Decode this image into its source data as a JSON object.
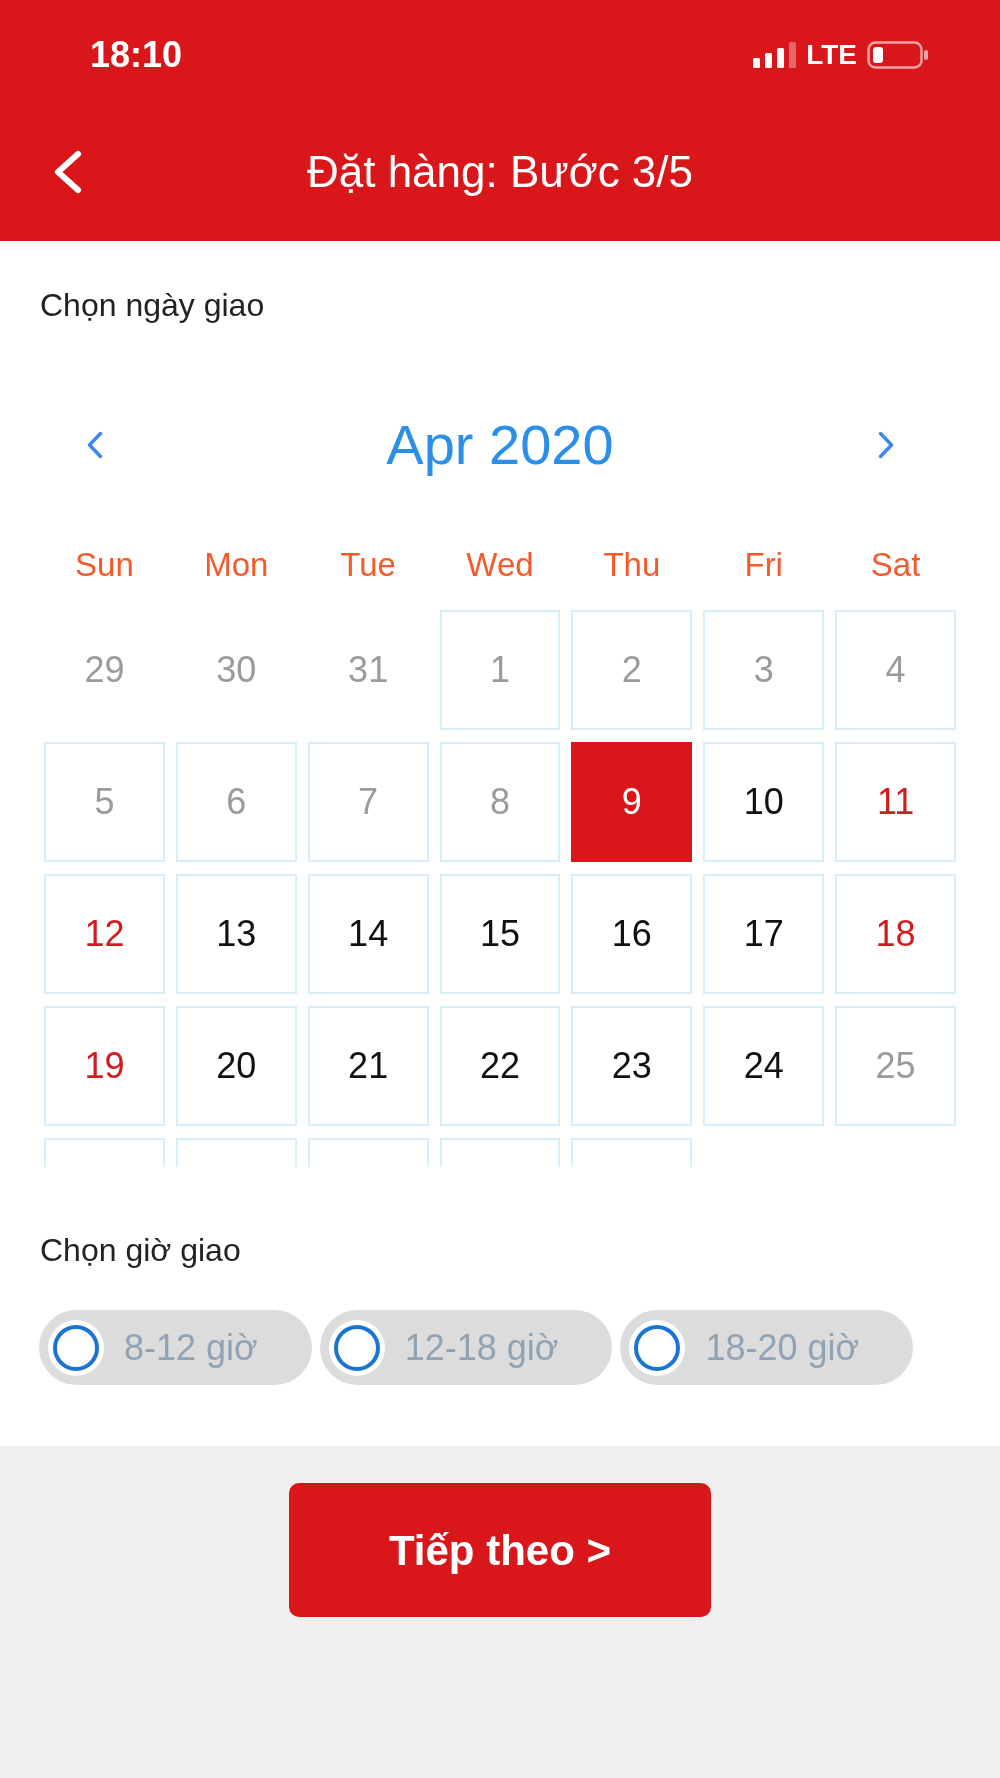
{
  "status_bar": {
    "time": "18:10",
    "network": "LTE"
  },
  "header": {
    "title": "Đặt hàng: Bước 3/5"
  },
  "date_section": {
    "label": "Chọn ngày giao",
    "calendar": {
      "month": "Apr 2020",
      "weekdays": [
        "Sun",
        "Mon",
        "Tue",
        "Wed",
        "Thu",
        "Fri",
        "Sat"
      ],
      "days": [
        {
          "label": "29",
          "kind": "outside",
          "selected": false
        },
        {
          "label": "30",
          "kind": "outside",
          "selected": false
        },
        {
          "label": "31",
          "kind": "outside",
          "selected": false
        },
        {
          "label": "1",
          "kind": "disabled",
          "selected": false
        },
        {
          "label": "2",
          "kind": "disabled",
          "selected": false
        },
        {
          "label": "3",
          "kind": "disabled",
          "selected": false
        },
        {
          "label": "4",
          "kind": "disabled",
          "selected": false
        },
        {
          "label": "5",
          "kind": "disabled",
          "selected": false
        },
        {
          "label": "6",
          "kind": "disabled",
          "selected": false
        },
        {
          "label": "7",
          "kind": "disabled",
          "selected": false
        },
        {
          "label": "8",
          "kind": "disabled",
          "selected": false
        },
        {
          "label": "9",
          "kind": "weekday",
          "selected": true
        },
        {
          "label": "10",
          "kind": "weekday",
          "selected": false
        },
        {
          "label": "11",
          "kind": "weekend",
          "selected": false
        },
        {
          "label": "12",
          "kind": "weekend",
          "selected": false
        },
        {
          "label": "13",
          "kind": "weekday",
          "selected": false
        },
        {
          "label": "14",
          "kind": "weekday",
          "selected": false
        },
        {
          "label": "15",
          "kind": "weekday",
          "selected": false
        },
        {
          "label": "16",
          "kind": "weekday",
          "selected": false
        },
        {
          "label": "17",
          "kind": "weekday",
          "selected": false
        },
        {
          "label": "18",
          "kind": "weekend",
          "selected": false
        },
        {
          "label": "19",
          "kind": "weekend",
          "selected": false
        },
        {
          "label": "20",
          "kind": "weekday",
          "selected": false
        },
        {
          "label": "21",
          "kind": "weekday",
          "selected": false
        },
        {
          "label": "22",
          "kind": "weekday",
          "selected": false
        },
        {
          "label": "23",
          "kind": "weekday",
          "selected": false
        },
        {
          "label": "24",
          "kind": "weekday",
          "selected": false
        },
        {
          "label": "25",
          "kind": "disabled",
          "selected": false
        },
        {
          "kind": "clipped",
          "selected": false
        },
        {
          "kind": "clipped",
          "selected": false
        },
        {
          "kind": "clipped",
          "selected": false
        },
        {
          "kind": "clipped",
          "selected": false
        },
        {
          "kind": "clipped",
          "selected": false
        }
      ]
    }
  },
  "time_section": {
    "label": "Chọn giờ giao",
    "slots": [
      {
        "label": "8-12 giờ",
        "selected": false
      },
      {
        "label": "12-18 giờ",
        "selected": false
      },
      {
        "label": "18-20 giờ",
        "selected": false
      }
    ]
  },
  "next_button": {
    "label": "Tiếp theo >"
  }
}
